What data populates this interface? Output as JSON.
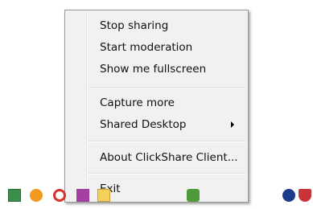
{
  "menu": {
    "items": [
      {
        "label": "Stop sharing"
      },
      {
        "label": "Start moderation"
      },
      {
        "label": "Show me fullscreen"
      },
      {
        "label": "Capture more"
      },
      {
        "label": "Shared Desktop"
      },
      {
        "label": "About ClickShare Client..."
      },
      {
        "label": "Exit"
      }
    ]
  },
  "taskbar": {
    "icons": [
      "clickshare-tray-icon",
      "orange-circle-icon",
      "red-ring-icon",
      "purple-app-icon",
      "yellow-folder-icon",
      "network-icon",
      "bluetooth-icon",
      "shield-icon"
    ]
  }
}
